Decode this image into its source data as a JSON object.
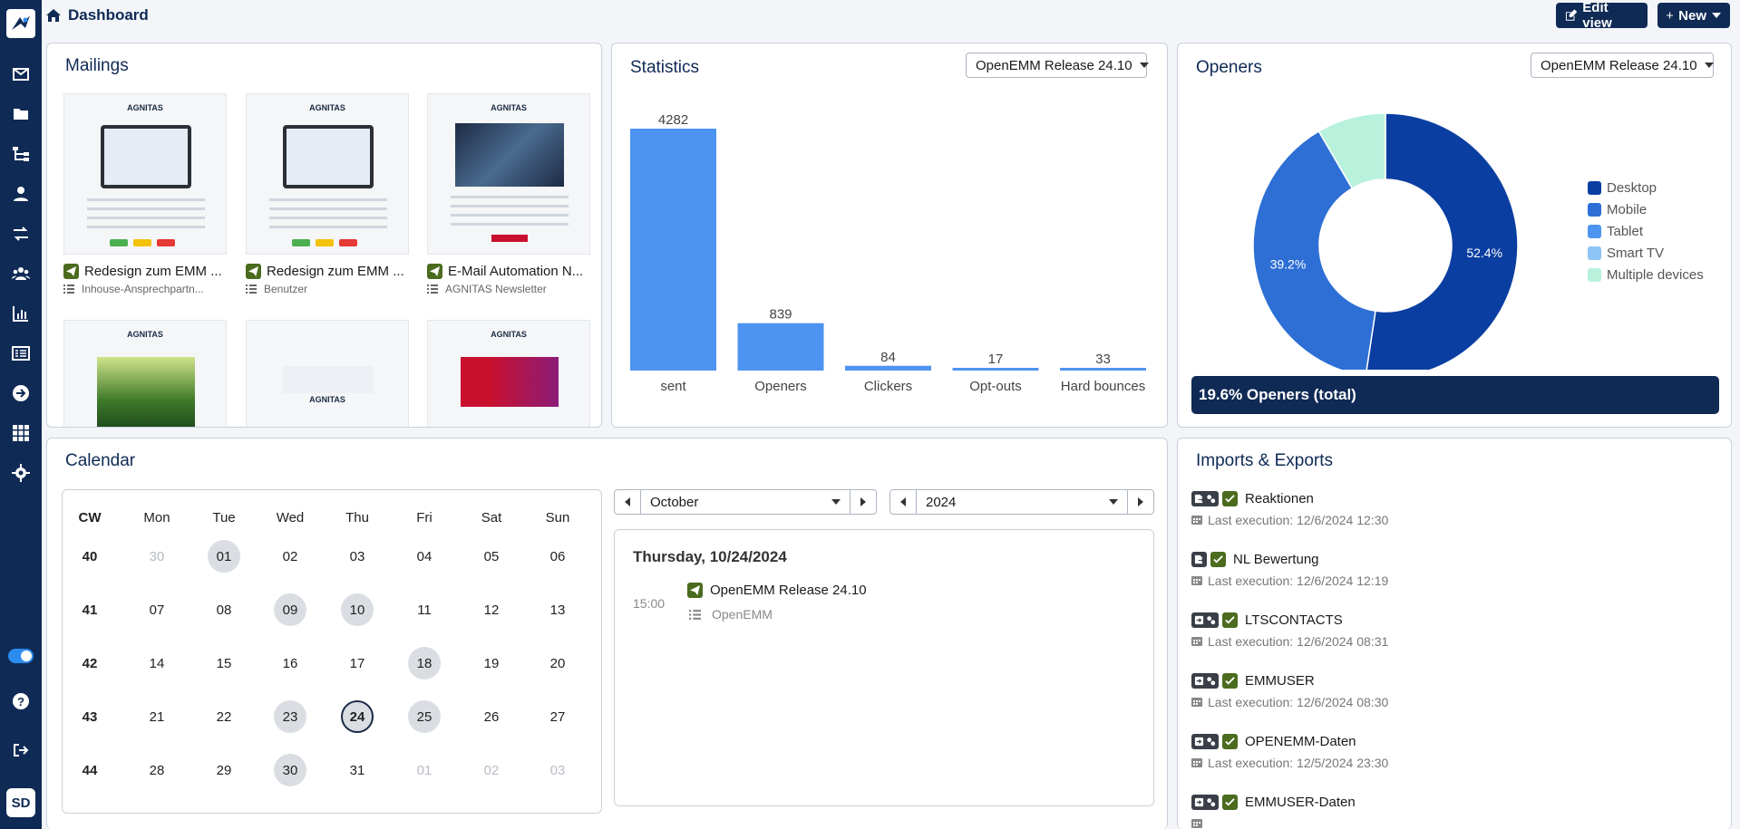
{
  "header": {
    "title": "Dashboard",
    "edit_view_label": "Edit view",
    "new_label": "New"
  },
  "sidebar": {
    "items": [
      {
        "icon": "envelope-icon"
      },
      {
        "icon": "folder-icon"
      },
      {
        "icon": "workflow-icon"
      },
      {
        "icon": "user-icon"
      },
      {
        "icon": "transfer-icon"
      },
      {
        "icon": "users-icon"
      },
      {
        "icon": "statistics-icon"
      },
      {
        "icon": "list-icon"
      },
      {
        "icon": "arrow-right-circle-icon"
      },
      {
        "icon": "grid-icon"
      },
      {
        "icon": "gear-icon"
      }
    ],
    "avatar_initials": "SD"
  },
  "mailings": {
    "title": "Mailings",
    "items": [
      {
        "name": "Redesign zum EMM ...",
        "list": "Inhouse-Ansprechpartn...",
        "brand": "AGNITAS"
      },
      {
        "name": "Redesign zum EMM ...",
        "list": "Benutzer",
        "brand": "AGNITAS"
      },
      {
        "name": "E-Mail Automation N...",
        "list": "AGNITAS Newsletter",
        "brand": "AGNITAS"
      },
      {
        "brand": "AGNITAS"
      },
      {
        "brand": "AGNITAS"
      },
      {
        "brand": "AGNITAS"
      }
    ]
  },
  "statistics": {
    "title": "Statistics",
    "selected_mailing": "OpenEMM Release 24.10"
  },
  "chart_data": [
    {
      "type": "bar",
      "categories": [
        "sent",
        "Openers",
        "Clickers",
        "Opt-outs",
        "Hard bounces"
      ],
      "values": [
        4282,
        839,
        84,
        17,
        33
      ],
      "title": "Statistics",
      "color": "#4d94f0"
    },
    {
      "type": "pie",
      "categories": [
        "Desktop",
        "Mobile",
        "Tablet",
        "Smart TV",
        "Multiple devices"
      ],
      "values": [
        52.4,
        39.2,
        0,
        0,
        8.4
      ],
      "value_labels": [
        "52.4%",
        "39.2%",
        "",
        "",
        ""
      ],
      "colors": [
        "#0b3ea1",
        "#2e6fd6",
        "#4d94f0",
        "#8cc4f5",
        "#b8f2dd"
      ],
      "title": "Openers",
      "legend": "right"
    }
  ],
  "openers": {
    "title": "Openers",
    "selected_mailing": "OpenEMM Release 24.10",
    "total_label": "19.6% Openers (total)",
    "legend": [
      "Desktop",
      "Mobile",
      "Tablet",
      "Smart TV",
      "Multiple devices"
    ]
  },
  "calendar": {
    "title": "Calendar",
    "headers": [
      "CW",
      "Mon",
      "Tue",
      "Wed",
      "Thu",
      "Fri",
      "Sat",
      "Sun"
    ],
    "month": "October",
    "year": "2024",
    "weeks": [
      {
        "cw": "40",
        "days": [
          "30",
          "01",
          "02",
          "03",
          "04",
          "05",
          "06"
        ]
      },
      {
        "cw": "41",
        "days": [
          "07",
          "08",
          "09",
          "10",
          "11",
          "12",
          "13"
        ]
      },
      {
        "cw": "42",
        "days": [
          "14",
          "15",
          "16",
          "17",
          "18",
          "19",
          "20"
        ]
      },
      {
        "cw": "43",
        "days": [
          "21",
          "22",
          "23",
          "24",
          "25",
          "26",
          "27"
        ]
      },
      {
        "cw": "44",
        "days": [
          "28",
          "29",
          "30",
          "31",
          "01",
          "02",
          "03"
        ]
      }
    ],
    "selected_day_title": "Thursday, 10/24/2024",
    "event": {
      "time": "15:00",
      "name": "OpenEMM Release 24.10",
      "list": "OpenEMM"
    }
  },
  "imports": {
    "title": "Imports & Exports",
    "items": [
      {
        "name": "Reaktionen",
        "last": "Last execution: 12/6/2024 12:30",
        "type": "export"
      },
      {
        "name": "NL Bewertung",
        "last": "Last execution: 12/6/2024 12:19",
        "type": "export"
      },
      {
        "name": "LTSCONTACTS",
        "last": "Last execution: 12/6/2024 08:31",
        "type": "import"
      },
      {
        "name": "EMMUSER",
        "last": "Last execution: 12/6/2024 08:30",
        "type": "import"
      },
      {
        "name": "OPENEMM-Daten",
        "last": "Last execution: 12/5/2024 23:30",
        "type": "import"
      },
      {
        "name": "EMMUSER-Daten",
        "last": "",
        "type": "import"
      }
    ]
  }
}
